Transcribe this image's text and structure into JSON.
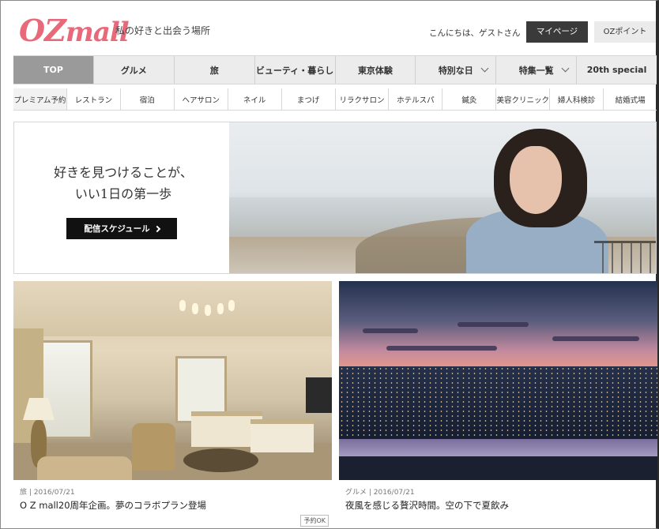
{
  "header": {
    "logo_main": "OZ",
    "logo_sub": "mall",
    "tagline": "私の好きと出会う場所",
    "greeting": "こんにちは、ゲストさん",
    "mypage_label": "マイページ",
    "point_label": "OZポイント"
  },
  "nav_primary": [
    {
      "label": "TOP",
      "active": true,
      "dropdown": false
    },
    {
      "label": "グルメ",
      "active": false,
      "dropdown": false
    },
    {
      "label": "旅",
      "active": false,
      "dropdown": false
    },
    {
      "label": "ビューティ・暮らし",
      "active": false,
      "dropdown": false
    },
    {
      "label": "東京体験",
      "active": false,
      "dropdown": false
    },
    {
      "label": "特別な日",
      "active": false,
      "dropdown": true
    },
    {
      "label": "特集一覧",
      "active": false,
      "dropdown": true
    },
    {
      "label": "20th special",
      "active": false,
      "dropdown": false
    }
  ],
  "nav_secondary": [
    "プレミアム予約",
    "レストラン",
    "宿泊",
    "ヘアサロン",
    "ネイル",
    "まつげ",
    "リラクサロン",
    "ホテルスパ",
    "鍼灸",
    "美容クリニック",
    "婦人科検診",
    "結婚式場"
  ],
  "hero": {
    "line1": "好きを見つけることが、",
    "line2": "いい1日の第一歩",
    "button_label": "配信スケジュール"
  },
  "cards": [
    {
      "category": "旅",
      "date": "2016/07/21",
      "meta": "旅 | 2016/07/21",
      "title": "O Z mall20周年企画。夢のコラボプラン登場",
      "badge": "予約OK"
    },
    {
      "category": "グルメ",
      "date": "2016/07/21",
      "meta": "グルメ | 2016/07/21",
      "title": "夜風を感じる贅沢時間。空の下で夏飲み",
      "badge": ""
    }
  ],
  "colors": {
    "brand": "#e8697a",
    "nav_active": "#9a9a9a",
    "button_dark": "#3a3a3a"
  }
}
